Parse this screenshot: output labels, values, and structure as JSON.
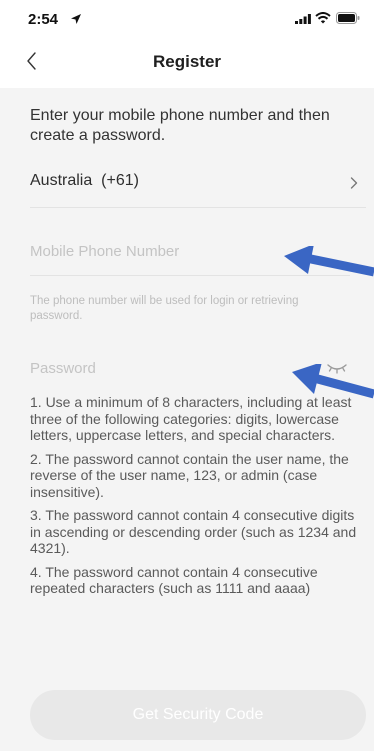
{
  "status_bar": {
    "time": "2:54",
    "icons": [
      "location-arrow-icon",
      "cellular-signal-icon",
      "wifi-icon",
      "battery-icon"
    ]
  },
  "nav": {
    "title": "Register",
    "back_icon": "chevron-left-icon"
  },
  "form": {
    "intro": "Enter your mobile phone number and then create a password.",
    "country": "Australia  (+61)",
    "phone_placeholder": "Mobile Phone Number",
    "phone_value": "",
    "phone_hint": "The phone number will be used for login or retrieving password.",
    "password_placeholder": "Password",
    "password_value": "",
    "password_toggle_icon": "eye-closed-icon",
    "rules": [
      "1. Use a minimum of 8 characters, including at least three of the following categories: digits, lowercase letters, uppercase letters, and special characters.",
      "2. The password cannot contain the user name, the reverse of the user name, 123, or admin (case insensitive).",
      "3. The password cannot contain 4 consecutive digits in ascending or descending order (such as 1234 and 4321).",
      "4. The password cannot contain 4 consecutive repeated characters (such as 1111 and aaaa)"
    ],
    "submit_label": "Get Security Code"
  },
  "colors": {
    "background": "#f4f4f4",
    "header": "#ffffff",
    "annotation_arrow": "#3a66c4",
    "button_disabled": "#e8e8e8"
  }
}
